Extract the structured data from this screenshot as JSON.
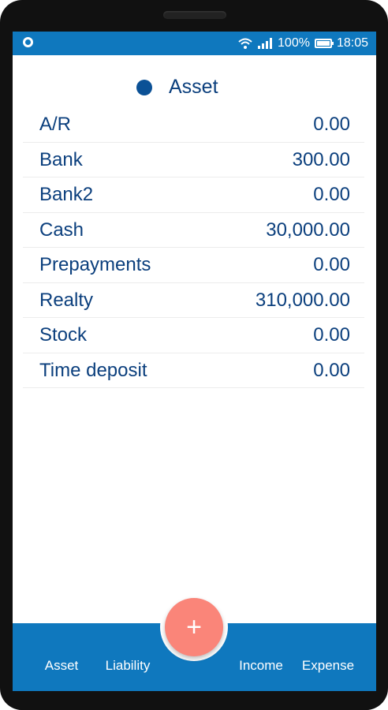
{
  "status_bar": {
    "battery_text": "100%",
    "time": "18:05"
  },
  "header": {
    "title": "Asset",
    "dot_color": "#0b5196"
  },
  "accounts": [
    {
      "label": "A/R",
      "value": "0.00"
    },
    {
      "label": "Bank",
      "value": "300.00"
    },
    {
      "label": "Bank2",
      "value": "0.00"
    },
    {
      "label": "Cash",
      "value": "30,000.00"
    },
    {
      "label": "Prepayments",
      "value": "0.00"
    },
    {
      "label": "Realty",
      "value": "310,000.00"
    },
    {
      "label": "Stock",
      "value": "0.00"
    },
    {
      "label": "Time deposit",
      "value": "0.00"
    }
  ],
  "bottom_nav": {
    "tabs": [
      "Asset",
      "Liability",
      "Income",
      "Expense"
    ],
    "fab_label": "+"
  },
  "colors": {
    "primary": "#0f78be",
    "text": "#0b3f7d",
    "fab": "#fa8579"
  }
}
